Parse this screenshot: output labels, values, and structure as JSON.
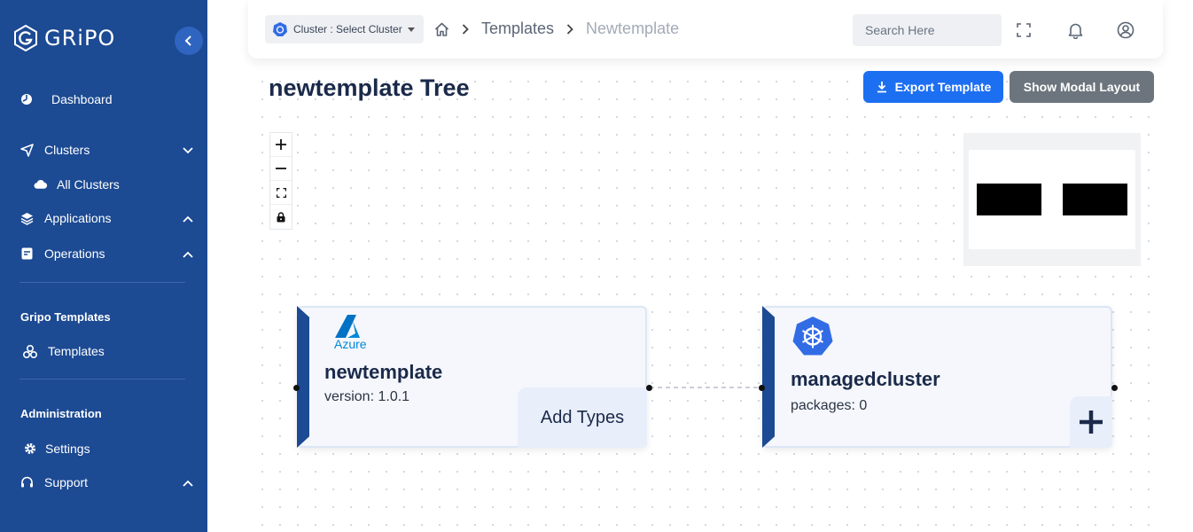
{
  "brand": {
    "name": "GRiPO"
  },
  "sidebar": {
    "items": [
      {
        "label": "Dashboard",
        "icon": "dashboard-icon"
      },
      {
        "label": "Clusters",
        "icon": "send-icon",
        "expanded": true
      },
      {
        "label": "All Clusters",
        "icon": "cloud-icon"
      },
      {
        "label": "Applications",
        "icon": "layers-icon",
        "expanded": false
      },
      {
        "label": "Operations",
        "icon": "document-icon",
        "expanded": false
      }
    ],
    "templates_section": "Gripo Templates",
    "templates_item": "Templates",
    "admin_section": "Administration",
    "settings": "Settings",
    "support": "Support"
  },
  "topbar": {
    "cluster_select": "Cluster : Select Cluster",
    "breadcrumb": {
      "link": "Templates",
      "current": "Newtemplate"
    },
    "search_placeholder": "Search Here"
  },
  "page": {
    "title": "newtemplate Tree",
    "export_button": "Export Template",
    "modal_button": "Show Modal Layout"
  },
  "nodes": {
    "template": {
      "provider": "Azure",
      "name": "newtemplate",
      "version": "version: 1.0.1",
      "action": "Add Types"
    },
    "cluster": {
      "name": "managedcluster",
      "packages": "packages: 0",
      "action": "+"
    }
  },
  "colors": {
    "sidebar": "#1c4a93",
    "primary": "#1d6ff2",
    "secondary": "#6c757d",
    "azure": "#0089d6",
    "kubernetes": "#326ce5"
  }
}
